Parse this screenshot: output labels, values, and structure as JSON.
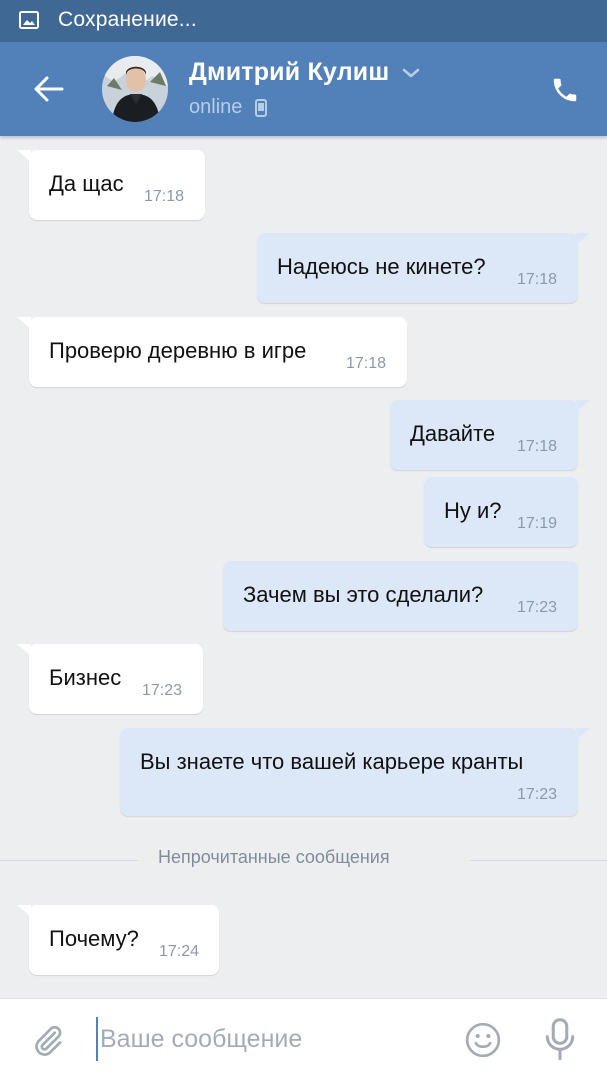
{
  "status_bar": {
    "text": "Сохранение...",
    "icon": "image-icon"
  },
  "header": {
    "contact_name": "Дмитрий Кулиш",
    "status": "online",
    "back_icon": "arrow-left-icon",
    "call_icon": "phone-icon",
    "mobile_icon": "mobile-device-icon",
    "accent_color": "#5181b8"
  },
  "messages": [
    {
      "direction": "in",
      "text": "Да щас",
      "time": "17:18"
    },
    {
      "direction": "out",
      "text": "Надеюсь не кинете?",
      "time": "17:18"
    },
    {
      "direction": "in",
      "text": "Проверю деревню в игре",
      "time": "17:18"
    },
    {
      "direction": "out",
      "text": "Давайте",
      "time": "17:18"
    },
    {
      "direction": "out",
      "text": "Ну и?",
      "time": "17:19"
    },
    {
      "direction": "out",
      "text": "Зачем вы это сделали?",
      "time": "17:23"
    },
    {
      "direction": "in",
      "text": "Бизнес",
      "time": "17:23"
    },
    {
      "direction": "out",
      "text": "Вы знаете что вашей карьере кранты",
      "time": "17:23"
    },
    {
      "direction": "in",
      "text": "Почему?",
      "time": "17:24"
    }
  ],
  "divider": {
    "label": "Непрочитанные сообщения"
  },
  "composer": {
    "placeholder": "Ваше сообщение",
    "value": "",
    "attach_icon": "paperclip-icon",
    "emoji_icon": "smile-icon",
    "mic_icon": "microphone-icon"
  },
  "colors": {
    "status_bar": "#3f6894",
    "header": "#5181b8",
    "incoming_bubble": "#ffffff",
    "outgoing_bubble": "#dce8f8",
    "background": "#edeef0"
  }
}
